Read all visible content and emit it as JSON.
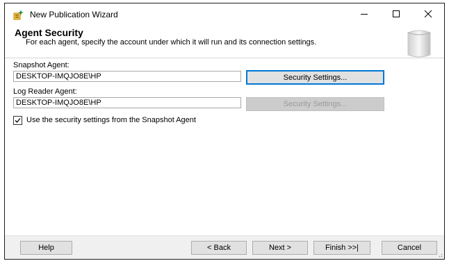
{
  "window": {
    "title": "New Publication Wizard"
  },
  "header": {
    "title": "Agent Security",
    "description": "For each agent, specify the account under which it will run and its connection settings."
  },
  "snapshot_agent": {
    "label": "Snapshot Agent:",
    "account": "DESKTOP-IMQJO8E\\HP",
    "button_label": "Security Settings..."
  },
  "log_reader_agent": {
    "label": "Log Reader Agent:",
    "account": "DESKTOP-IMQJO8E\\HP",
    "button_label": "Security Settings..."
  },
  "use_snapshot_settings": {
    "label": "Use the security settings from the Snapshot Agent",
    "checked": true
  },
  "footer": {
    "help": "Help",
    "back": "< Back",
    "next": "Next >",
    "finish": "Finish >>|",
    "cancel": "Cancel"
  },
  "icons": {
    "app": "wizard-app-icon",
    "minimize": "minimize-icon",
    "maximize": "maximize-icon",
    "close": "close-icon",
    "header": "header-graphic-icon"
  },
  "colors": {
    "focus": "#0078d7",
    "disabled_text": "#9a9a9a",
    "footer_bg": "#f0f0f0"
  }
}
